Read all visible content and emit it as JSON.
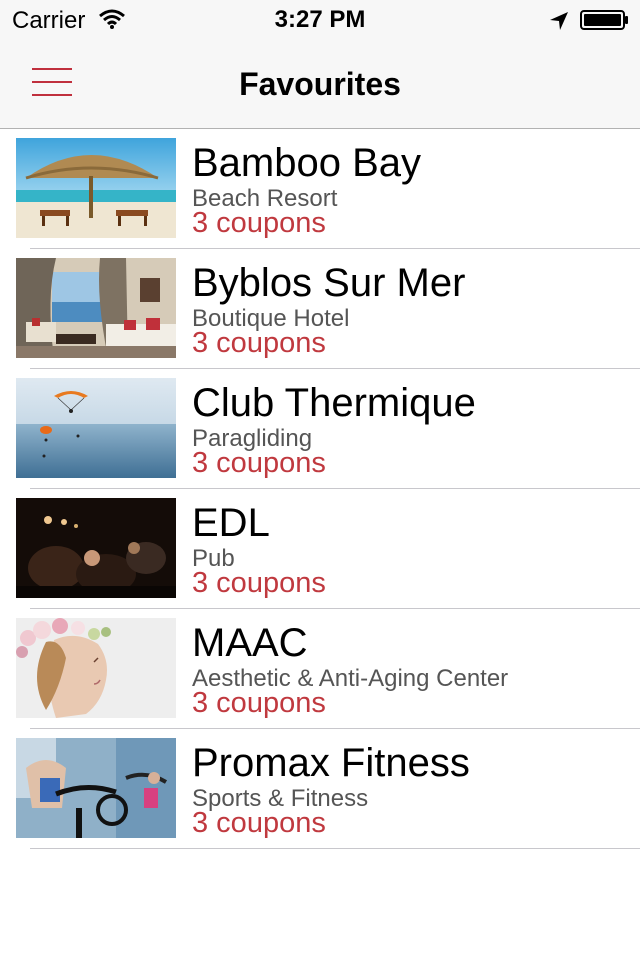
{
  "status_bar": {
    "carrier": "Carrier",
    "time": "3:27 PM",
    "icons": [
      "wifi-icon",
      "location-arrow-icon",
      "battery-icon"
    ]
  },
  "nav": {
    "title": "Favourites",
    "menu_icon": "hamburger-menu-icon",
    "accent_color": "#c0393f"
  },
  "favourites": [
    {
      "name": "Bamboo Bay",
      "category": "Beach Resort",
      "coupons": "3 coupons",
      "thumbnail": "beach-umbrella-photo"
    },
    {
      "name": "Byblos Sur Mer",
      "category": "Boutique Hotel",
      "coupons": "3 coupons",
      "thumbnail": "hotel-room-photo"
    },
    {
      "name": "Club Thermique",
      "category": "Paragliding",
      "coupons": "3 coupons",
      "thumbnail": "paragliders-over-sea-photo"
    },
    {
      "name": "EDL",
      "category": "Pub",
      "coupons": "3 coupons",
      "thumbnail": "pub-crowd-photo"
    },
    {
      "name": "MAAC",
      "category": "Aesthetic & Anti-Aging Center",
      "coupons": "3 coupons",
      "thumbnail": "woman-flower-crown-photo"
    },
    {
      "name": "Promax Fitness",
      "category": "Sports & Fitness",
      "coupons": "3 coupons",
      "thumbnail": "spin-class-photo"
    }
  ]
}
